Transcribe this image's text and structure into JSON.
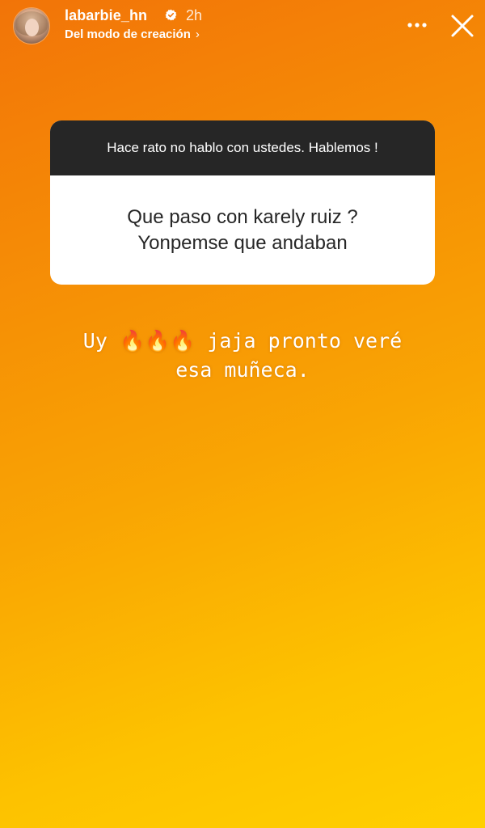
{
  "header": {
    "username": "labarbie_hn",
    "time_ago": "2h",
    "subtitle": "Del modo de creación",
    "subtitle_chevron": "›"
  },
  "icons": {
    "verified": "verified-badge-icon",
    "more": "more-horizontal-icon",
    "close": "close-icon"
  },
  "question_sticker": {
    "prompt": "Hace rato no hablo con ustedes. Hablemos !",
    "answer_lines": [
      "Que paso con karely ruiz ?",
      "Yonpemse que andaban"
    ]
  },
  "reply": {
    "text_before": "Uy ",
    "emojis": "🔥🔥🔥",
    "text_after": " jaja pronto veré",
    "line2": "esa muñeca."
  },
  "colors": {
    "gradient_start": "#f27408",
    "gradient_end": "#ffd000",
    "prompt_bg": "#262626",
    "answer_bg": "#ffffff"
  }
}
